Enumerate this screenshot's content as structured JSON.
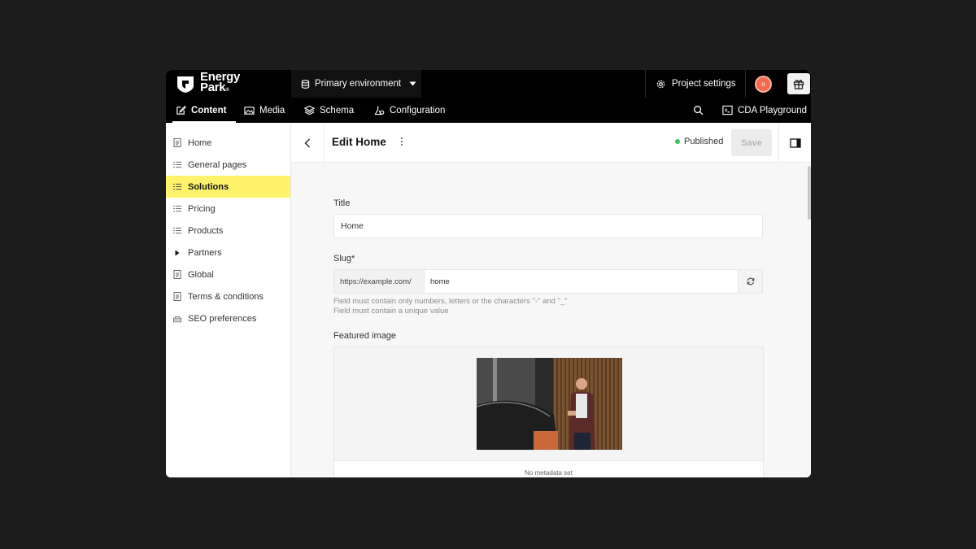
{
  "brand": {
    "line1": "Energy",
    "line2": "Park",
    "mark": "®"
  },
  "header": {
    "environment": "Primary environment",
    "project_settings": "Project settings",
    "avatar_initial": "o",
    "accent_color": "#f26a4f"
  },
  "nav": {
    "tabs": [
      {
        "label": "Content",
        "icon": "edit-icon",
        "active": true
      },
      {
        "label": "Media",
        "icon": "image-icon"
      },
      {
        "label": "Schema",
        "icon": "layers-icon"
      },
      {
        "label": "Configuration",
        "icon": "configuration-icon"
      }
    ],
    "cda_playground": "CDA Playground"
  },
  "sidebar": {
    "items": [
      {
        "label": "Home",
        "icon": "document-icon"
      },
      {
        "label": "General pages",
        "icon": "list-icon"
      },
      {
        "label": "Solutions",
        "icon": "list-icon",
        "active": true
      },
      {
        "label": "Pricing",
        "icon": "list-icon"
      },
      {
        "label": "Products",
        "icon": "list-icon"
      },
      {
        "label": "Partners",
        "icon": "caret-right-icon"
      },
      {
        "label": "Global",
        "icon": "document-icon"
      },
      {
        "label": "Terms & conditions",
        "icon": "document-icon"
      },
      {
        "label": "SEO preferences",
        "icon": "settings-icon"
      }
    ],
    "active_color": "#fff36b"
  },
  "editor": {
    "title": "Edit Home",
    "status": "Published",
    "status_color": "#34c759",
    "save_label": "Save"
  },
  "form": {
    "title_label": "Title",
    "title_value": "Home",
    "slug_label": "Slug*",
    "slug_prefix": "https://example.com/",
    "slug_value": "home",
    "slug_hint_1": "Field must contain only numbers, letters or the characters \"-\" and \"_\"",
    "slug_hint_2": "Field must contain a unique value",
    "image_label": "Featured image",
    "image_meta": "No metadata set"
  }
}
